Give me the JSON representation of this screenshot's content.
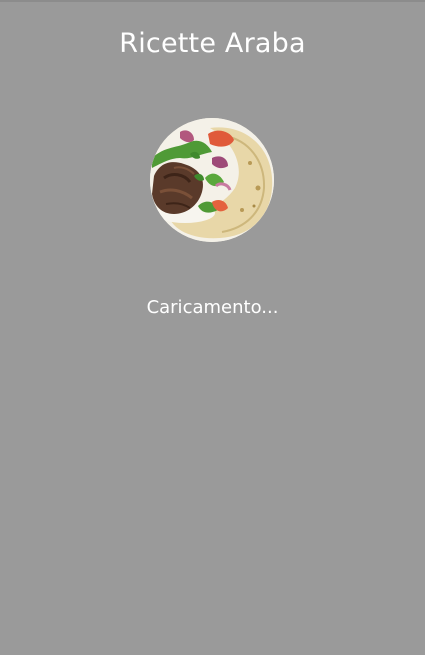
{
  "app": {
    "title": "Ricette Araba",
    "loading_text": "Caricamento..."
  },
  "logo": {
    "icon": "shawarma-wrap-image"
  },
  "colors": {
    "background": "#9a9a9a",
    "text": "#ffffff"
  }
}
